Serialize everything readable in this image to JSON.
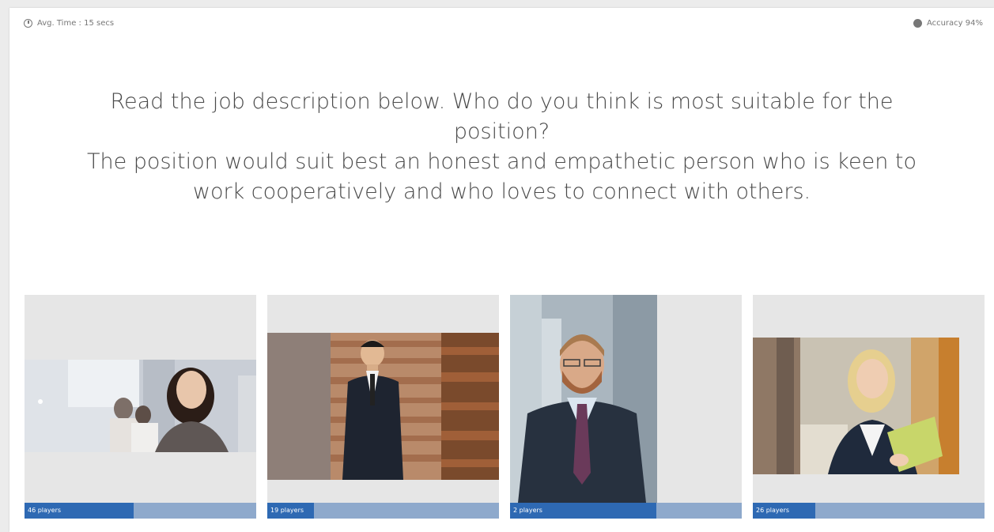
{
  "stats": {
    "avg_time": "Avg. Time : 15 secs",
    "accuracy": "Accuracy 94%"
  },
  "question": {
    "line1": "Read the job description below. Who do you think is most suitable for the",
    "line2": "position?",
    "line3": "The position would suit best an honest and empathetic person who is keen to",
    "line4": "work cooperatively and who loves to connect with others."
  },
  "options": [
    {
      "players_label": "46 players",
      "share": 0.47,
      "image": "photo-woman-office"
    },
    {
      "players_label": "19 players",
      "share": 0.2,
      "image": "photo-man-suit-wood-wall"
    },
    {
      "players_label": "2 players",
      "share": 0.63,
      "image": "photo-man-beard-tie"
    },
    {
      "players_label": "26 players",
      "share": 0.27,
      "image": "photo-woman-blonde-folder"
    }
  ],
  "colors": {
    "bar_fill": "#2e69b3",
    "bar_track": "#8ea9cc",
    "tile_bg": "#e6e6e6",
    "question_text": "#4a4a4a"
  }
}
